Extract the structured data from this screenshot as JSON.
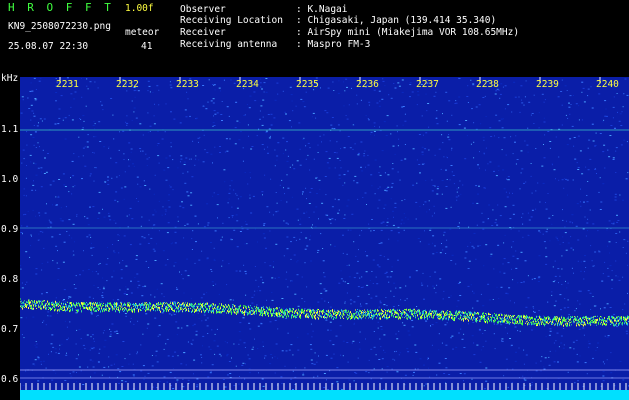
{
  "app": {
    "title": "H R O F F T",
    "version": "1.00f",
    "file_name": "KN9_2508072230.png",
    "meteor_label": "meteor",
    "datetime": "25.08.07 22:30",
    "meteor_count": "41"
  },
  "info": {
    "labels": [
      "Observer",
      "Receiving Location",
      "Receiver",
      "Receiving antenna"
    ],
    "values": [
      ": K.Nagai",
      ": Chigasaki, Japan (139.414 35.340)",
      ": AirSpy mini (Miakejima VOR 108.65MHz)",
      ": Maspro FM-3"
    ]
  },
  "axis": {
    "unit": "kHz",
    "time_ticks": [
      "2231",
      "2232",
      "2233",
      "2234",
      "2235",
      "2236",
      "2237",
      "2238",
      "2239",
      "2240"
    ],
    "freq_ticks": [
      "1.1",
      "1.0",
      "0.9",
      "0.8",
      "0.7",
      "0.6"
    ]
  },
  "colors": {
    "background": "#000000",
    "spectrum_bg": "#0a1ea8",
    "signal": "#40ff40",
    "header_yellow": "#ffff40",
    "floor": "#00e0ff"
  }
}
